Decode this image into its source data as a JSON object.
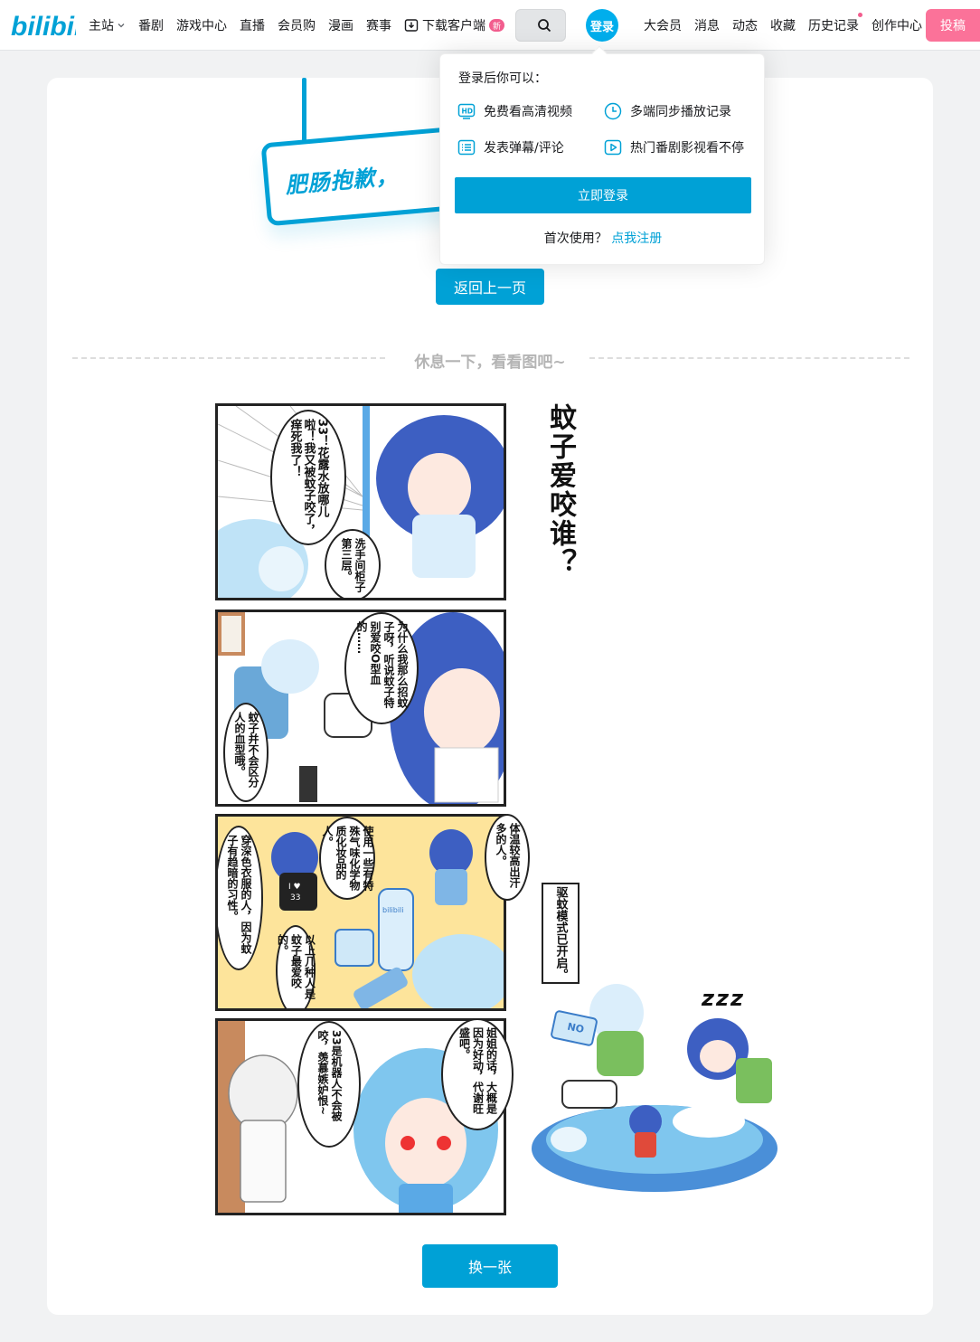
{
  "header": {
    "logo": "bilibili",
    "nav_left": [
      "主站",
      "番剧",
      "游戏中心",
      "直播",
      "会员购",
      "漫画",
      "赛事"
    ],
    "download_label": "下载客户端",
    "download_badge": "新",
    "login_label": "登录",
    "nav_right": [
      "大会员",
      "消息",
      "动态",
      "收藏",
      "历史记录",
      "创作中心"
    ],
    "upload_label": "投稿"
  },
  "error": {
    "sign_text": "肥肠抱歉，",
    "back_button": "返回上一页",
    "divider_text": "休息一下，看看图吧~",
    "change_button": "换一张"
  },
  "comic": {
    "title": "蚊子爱咬谁？",
    "panel1_bubble_a": "33！花露水放哪儿啦！我又被蚊子咬了，痒死我了！",
    "panel1_bubble_b": "洗手间柜子第三层。",
    "panel2_bubble_a": "为什么我那么招蚊子呀，听说蚊子特别爱咬O型血的……",
    "panel2_bubble_b": "蚊子并不会区分人的血型哦。",
    "panel3_bubble_a": "体温较高出汗多的人。",
    "panel3_bubble_b": "使用一些有特殊气味化学物质化妆品的人。",
    "panel3_bubble_c": "穿深色衣服的人，因为蚊子有趋暗的习性。",
    "panel3_bubble_d": "以上几种人是蚊子最爱咬的。",
    "panel4_bubble_a": "姐姐的话，大概是因为好动，代谢旺盛吧。",
    "panel4_bubble_b": "33是机器人不会被咬，羡慕嫉妒恨~",
    "side_sign": "驱蚊模式已开启。",
    "zzz": "zzz",
    "tablet_text": "ON",
    "shirt_text_line1": "I ♥",
    "shirt_text_line2": "33",
    "bottle_label": "bilibili"
  },
  "popover": {
    "title": "登录后你可以：",
    "perks": [
      {
        "icon": "hd-icon",
        "label": "免费看高清视频"
      },
      {
        "icon": "clock-icon",
        "label": "多端同步播放记录"
      },
      {
        "icon": "list-icon",
        "label": "发表弹幕/评论"
      },
      {
        "icon": "play-icon",
        "label": "热门番剧影视看不停"
      }
    ],
    "login_button": "立即登录",
    "register_prompt": "首次使用？",
    "register_link": "点我注册"
  },
  "colors": {
    "brand_blue": "#00a1d6",
    "header_login_blue": "#00aeec",
    "pink": "#fb7299",
    "background": "#f1f2f3"
  }
}
